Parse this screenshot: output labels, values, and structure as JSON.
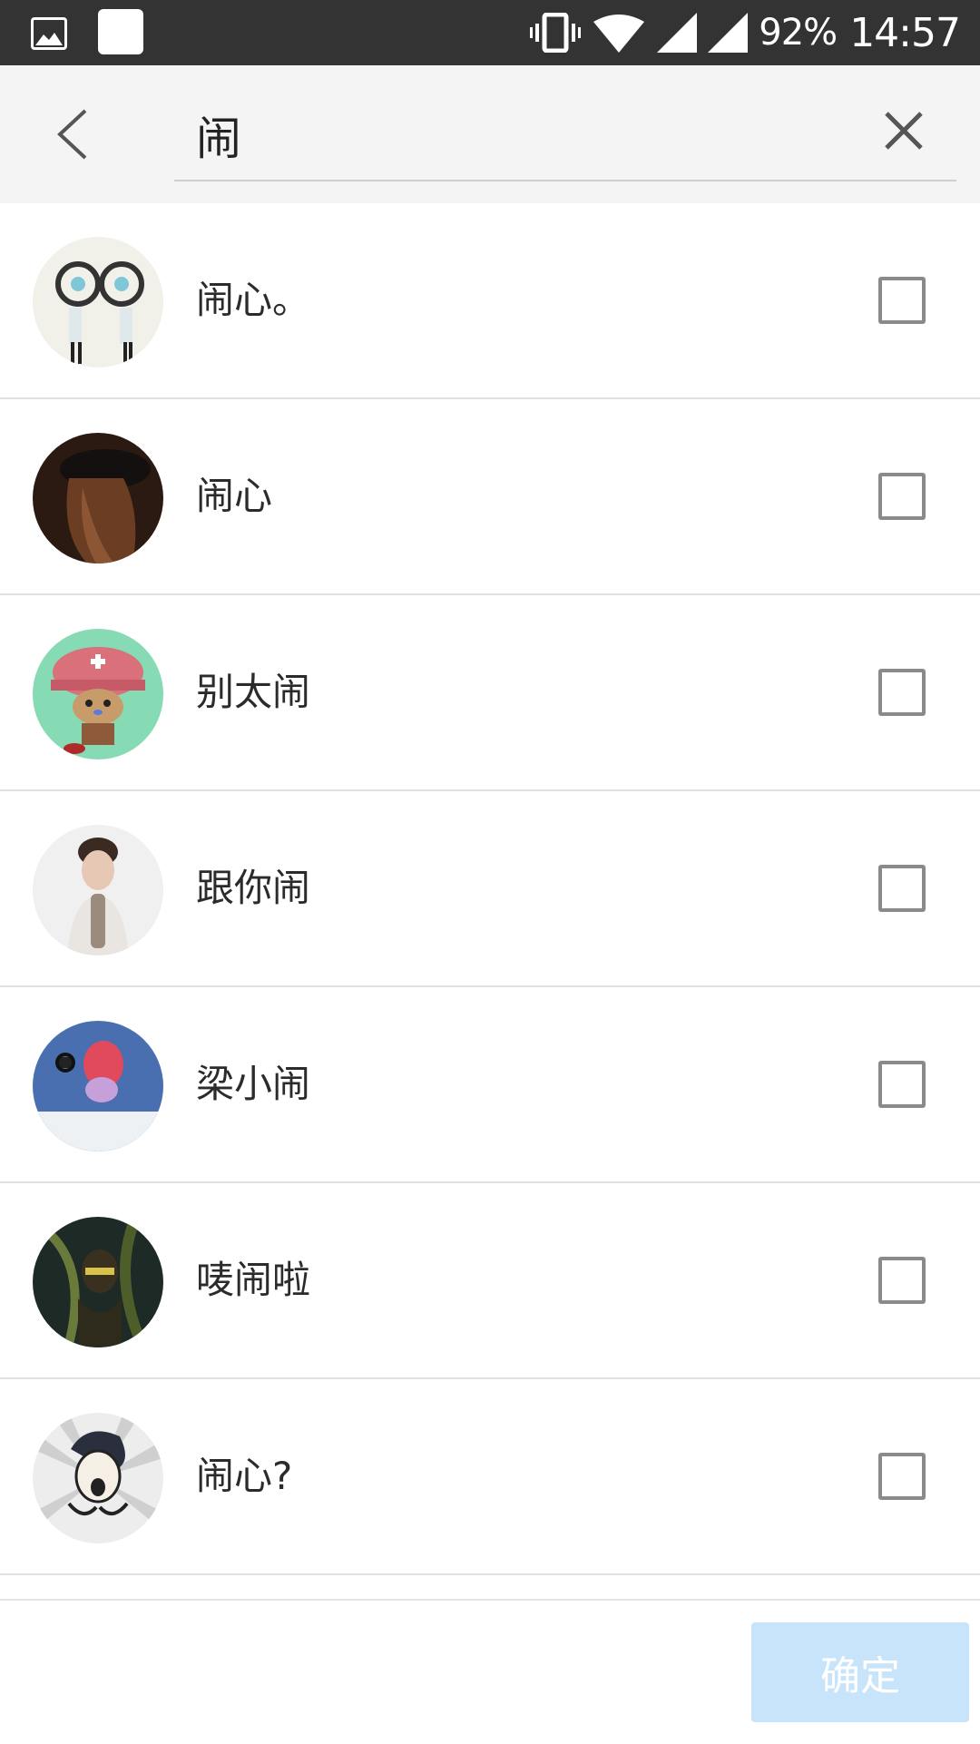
{
  "status_bar": {
    "battery": "92%",
    "time": "14:57",
    "icons": [
      "image-icon",
      "app-square-icon",
      "vibrate-icon",
      "wifi-icon",
      "cell-signal-icon",
      "cell-signal-icon"
    ]
  },
  "search": {
    "value": "闹",
    "back_icon": "chevron-left-icon",
    "clear_icon": "close-icon"
  },
  "contacts": [
    {
      "name": "闹心。",
      "checked": false
    },
    {
      "name": "闹心",
      "checked": false
    },
    {
      "name": "别太闹",
      "checked": false
    },
    {
      "name": "跟你闹",
      "checked": false
    },
    {
      "name": "梁小闹",
      "checked": false
    },
    {
      "name": "唛闹啦",
      "checked": false
    },
    {
      "name": "闹心?",
      "checked": false
    }
  ],
  "footer": {
    "confirm_label": "确定",
    "confirm_enabled": false
  },
  "colors": {
    "status_bar_bg": "#333333",
    "header_bg": "#f4f4f4",
    "confirm_disabled_bg": "#c8e4fa"
  }
}
